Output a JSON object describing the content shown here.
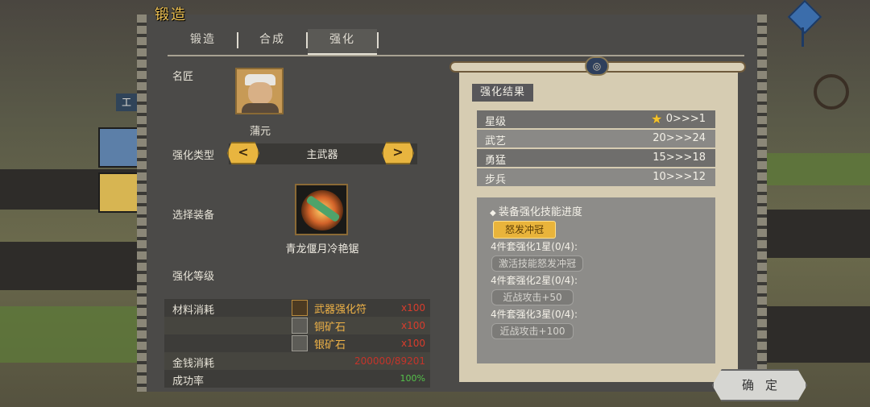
{
  "window": {
    "title": "锻造"
  },
  "tabs": [
    {
      "label": "锻造"
    },
    {
      "label": "合成"
    },
    {
      "label": "强化"
    }
  ],
  "side": {
    "label": "工"
  },
  "smith": {
    "label": "名匠",
    "name": "蒲元"
  },
  "type": {
    "label": "强化类型",
    "value": "主武器"
  },
  "equipment": {
    "label": "选择装备",
    "name": "青龙偃月冷艳锯"
  },
  "level": {
    "label": "强化等级"
  },
  "materials": {
    "label": "材料消耗",
    "items": [
      {
        "name": "武器强化符",
        "qty": "x100"
      },
      {
        "name": "铜矿石",
        "qty": "x100"
      },
      {
        "name": "银矿石",
        "qty": "x100"
      }
    ]
  },
  "money": {
    "label": "金钱消耗",
    "value": "200000/89201"
  },
  "rate": {
    "label": "成功率",
    "value": "100%"
  },
  "result": {
    "title": "强化结果",
    "stats": [
      {
        "name": "星级",
        "value": "0>>>1"
      },
      {
        "name": "武艺",
        "value": "20>>>24"
      },
      {
        "name": "勇猛",
        "value": "15>>>18"
      },
      {
        "name": "步兵",
        "value": "10>>>12"
      }
    ]
  },
  "skill": {
    "title": "装备强化技能进度",
    "badge": "怒发冲冠",
    "sets": [
      {
        "label": "4件套强化1星(0/4):",
        "effect": "激活技能怒发冲冠"
      },
      {
        "label": "4件套强化2星(0/4):",
        "effect": "近战攻击+50"
      },
      {
        "label": "4件套强化3星(0/4):",
        "effect": "近战攻击+100"
      }
    ]
  },
  "confirm": {
    "label": "确定"
  },
  "colors": {
    "accent_gold": "#e8b53f",
    "money_red": "#c4342a",
    "rate_green": "#55c24a",
    "material_orange": "#f0b347"
  }
}
